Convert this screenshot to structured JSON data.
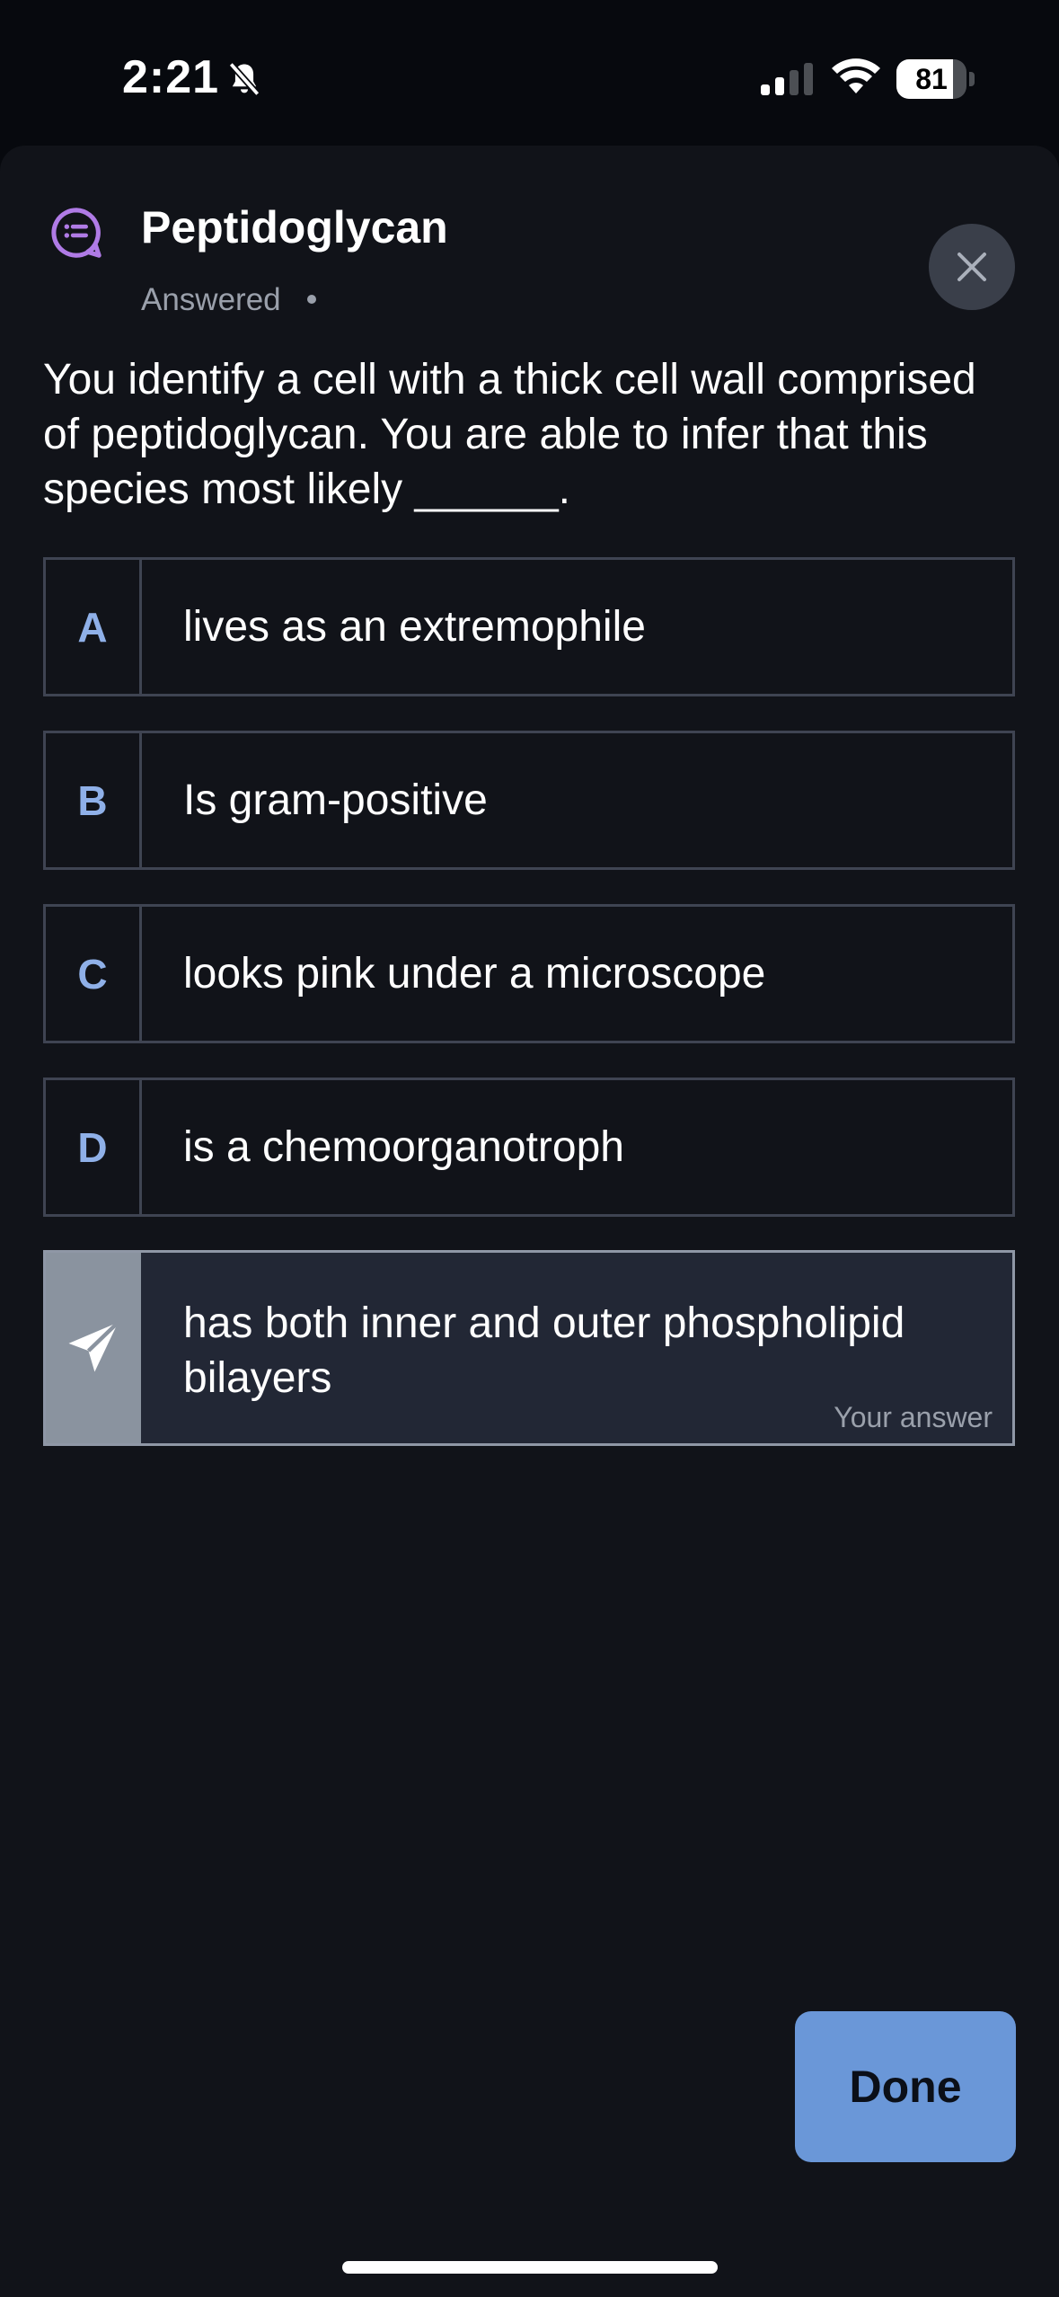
{
  "status_bar": {
    "time": "2:21",
    "battery_percent": 81,
    "battery_label": "81",
    "icons": [
      "bell-slash-icon",
      "cellular-signal-icon",
      "wifi-icon",
      "battery-icon"
    ]
  },
  "header": {
    "topic_icon": "chat-list-icon",
    "title": "Peptidoglycan",
    "status": "Answered",
    "close_icon": "close-icon"
  },
  "question": {
    "text": "You identify a cell with a thick cell wall comprised of peptidoglycan. You are able to infer that this species most likely ______."
  },
  "options": [
    {
      "letter": "A",
      "text": "lives as an extremophile"
    },
    {
      "letter": "B",
      "text": "Is gram-positive"
    },
    {
      "letter": "C",
      "text": "looks pink under a microscope"
    },
    {
      "letter": "D",
      "text": "is a chemoorganotroph"
    }
  ],
  "selected_answer": {
    "icon": "send-arrow-icon",
    "text": "has both inner and outer phospholipid bilayers",
    "label": "Your answer"
  },
  "footer": {
    "done_label": "Done"
  },
  "colors": {
    "background": "#111319",
    "accent": "#6a97d8",
    "option_letter": "#8fb0e8",
    "topic_icon": "#b07be6",
    "selected_background": "#222735"
  }
}
